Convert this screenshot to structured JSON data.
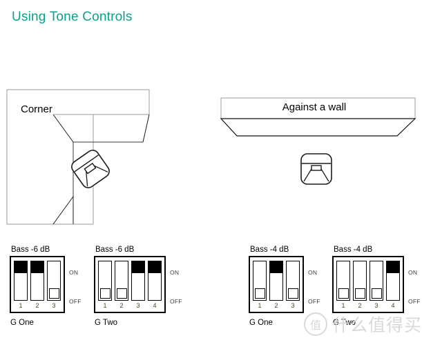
{
  "page": {
    "title": "Using Tone Controls"
  },
  "diagrams": [
    {
      "id": "corner",
      "label": "Corner",
      "icon": "speaker-icon"
    },
    {
      "id": "wall",
      "label": "Against a wall",
      "icon": "speaker-icon"
    }
  ],
  "dip_groups": [
    {
      "title": "Bass -6 dB",
      "footer": "G One",
      "on_label": "ON",
      "off_label": "OFF",
      "switches": [
        {
          "number": "1",
          "state": "on"
        },
        {
          "number": "2",
          "state": "on"
        },
        {
          "number": "3",
          "state": "off"
        }
      ]
    },
    {
      "title": "Bass -6 dB",
      "footer": "G Two",
      "on_label": "ON",
      "off_label": "OFF",
      "switches": [
        {
          "number": "1",
          "state": "off"
        },
        {
          "number": "2",
          "state": "off"
        },
        {
          "number": "3",
          "state": "on"
        },
        {
          "number": "4",
          "state": "on"
        }
      ]
    },
    {
      "title": "Bass -4 dB",
      "footer": "G One",
      "on_label": "ON",
      "off_label": "OFF",
      "switches": [
        {
          "number": "1",
          "state": "off"
        },
        {
          "number": "2",
          "state": "on"
        },
        {
          "number": "3",
          "state": "off"
        }
      ]
    },
    {
      "title": "Bass -4 dB",
      "footer": "G Two",
      "on_label": "ON",
      "off_label": "OFF",
      "switches": [
        {
          "number": "1",
          "state": "off"
        },
        {
          "number": "2",
          "state": "off"
        },
        {
          "number": "3",
          "state": "off"
        },
        {
          "number": "4",
          "state": "on"
        }
      ]
    }
  ],
  "watermark": {
    "mark": "值",
    "text": "什么值得买"
  },
  "colors": {
    "title": "#0aa18a",
    "wall_outline": "#000000",
    "wall_top_outline": "#808080",
    "switch_on": "#000000",
    "number": "#4a4020",
    "onoff_label": "#3b3b3b",
    "watermark": "#d9d9d9"
  }
}
